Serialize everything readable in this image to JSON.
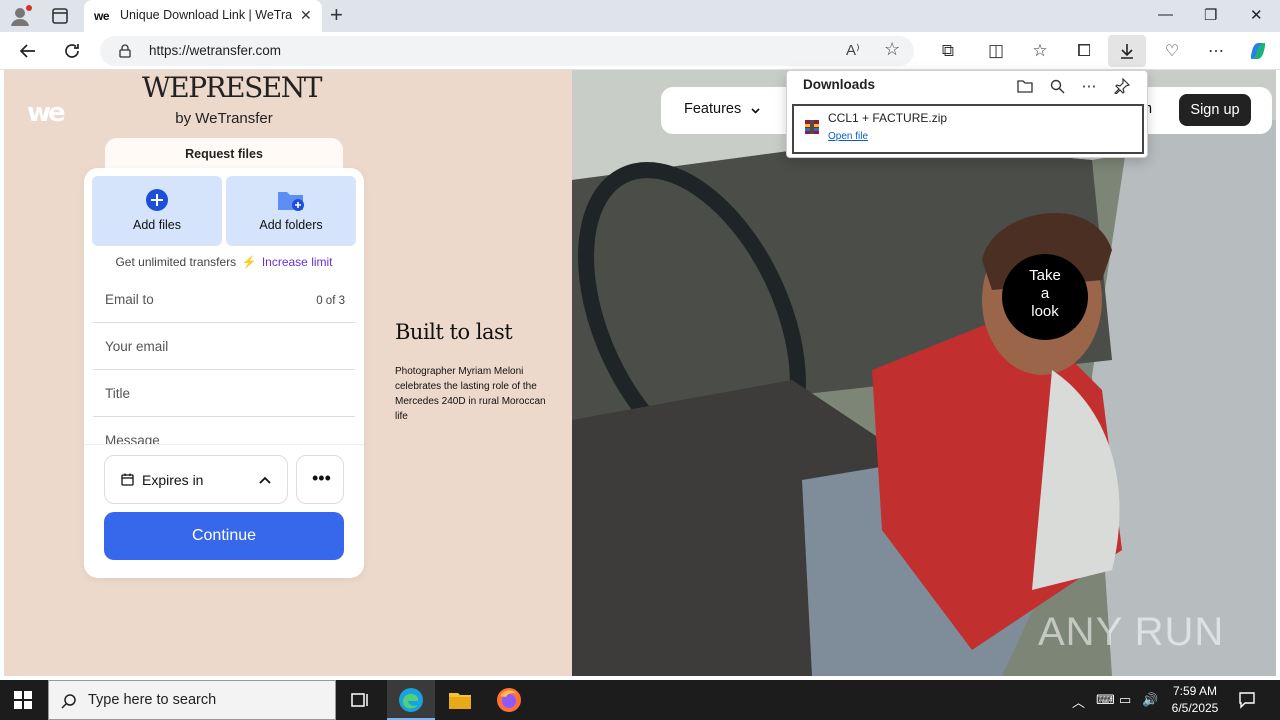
{
  "browser": {
    "tab": {
      "title": "Unique Download Link | WeTransfer",
      "favicon_text": "we"
    },
    "address": "https://wetransfer.com",
    "colors": {
      "accent": "#0a5ec7",
      "edge_download_highlight": "#d9d9d9"
    }
  },
  "downloads": {
    "title": "Downloads",
    "item": {
      "filename": "CCL1 + FACTURE.zip",
      "action": "Open file"
    }
  },
  "page": {
    "logo_text": "we",
    "wepresent": "WEPRESENT",
    "by_wetransfer": "by WeTransfer",
    "request_files": "Request files",
    "add_files": "Add files",
    "add_folders": "Add folders",
    "unlimited": "Get unlimited transfers",
    "increase_limit": "Increase limit",
    "email_to": "Email to",
    "email_count": "0 of 3",
    "your_email": "Your email",
    "title_field": "Title",
    "message_field": "Message",
    "expires": "Expires in",
    "continue": "Continue",
    "built_title": "Built to last",
    "built_desc": "Photographer Myriam Meloni celebrates the lasting role of the Mercedes 240D in rural Moroccan life",
    "nav_features": "Features",
    "nav_right_partial": "n",
    "sign_up": "Sign up",
    "take_a_look": [
      "Take",
      "a",
      "look"
    ],
    "watermark": "ANY RUN",
    "colors": {
      "bg": "#ecd9cc",
      "primary": "#3767ea",
      "add_bg": "#d6e4fb",
      "limit": "#6b2fd6"
    }
  },
  "taskbar": {
    "search_placeholder": "Type here to search",
    "time": "7:59 AM",
    "date": "6/5/2025"
  }
}
